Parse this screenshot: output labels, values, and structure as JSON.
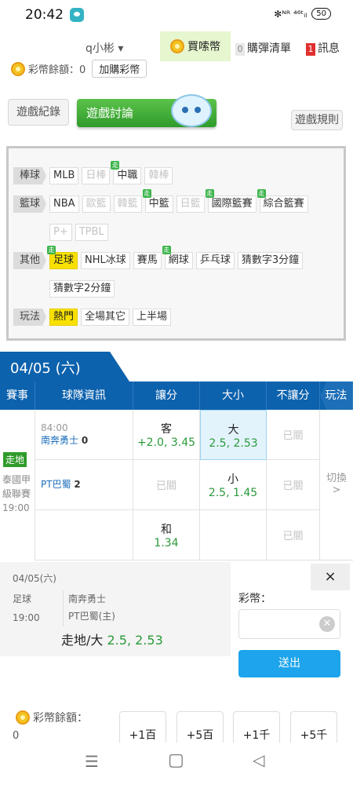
{
  "status": {
    "time": "20:42",
    "indicators": "✻ᴺᴿ ⁴⁶ᵗᵢₗ",
    "battery": "50"
  },
  "topnav": {
    "user": "q小彬 ▾",
    "buy": "買嗦幣",
    "cart_count": "0",
    "cart": "購彈清單",
    "msg_count": "1",
    "msg": "訊息"
  },
  "balance": {
    "label": "彩幣餘額：0",
    "button": "加購彩幣"
  },
  "tabs": {
    "history": "遊戲紀錄",
    "discuss": "遊戲討論",
    "rules": "遊戲規則"
  },
  "categories": {
    "baseball": {
      "head": "棒球",
      "items": [
        "MLB",
        "日棒",
        "中職",
        "韓棒"
      ]
    },
    "basketball": {
      "head": "籃球",
      "items": [
        "NBA",
        "歐籃",
        "韓籃",
        "中籃",
        "日籃",
        "國際籃賽",
        "綜合籃賽",
        "P+",
        "TPBL"
      ]
    },
    "other": {
      "head": "其他",
      "items": [
        "足球",
        "NHL冰球",
        "賽馬",
        "網球",
        "乒乓球",
        "猜數字3分鐘",
        "猜數字2分鐘"
      ]
    },
    "play": {
      "head": "玩法",
      "items": [
        "熱門",
        "全場其它",
        "上半場"
      ]
    },
    "zou_label": "走"
  },
  "date": "04/05 (六)",
  "table": {
    "headers": [
      "賽事",
      "球隊資訊",
      "讓分",
      "大小",
      "不讓分",
      "玩法"
    ],
    "zoudi": "走地",
    "league": "泰國甲級聯賽",
    "time": "19:00",
    "switch": "切換",
    "switch_arrow": ">",
    "team1": {
      "clock": "84:00",
      "name": "南奔勇士",
      "score": "0"
    },
    "team2": {
      "name": "PT巴蜀",
      "score": "2"
    },
    "row1": {
      "handicap_k": "客",
      "handicap_v": "+2.0, 3.45",
      "ou_k": "大",
      "ou_v": "2.5, 2.53",
      "nohandi": "已關"
    },
    "row2": {
      "handicap": "已關",
      "ou_k": "小",
      "ou_v": "2.5, 1.45",
      "nohandi": "已關"
    },
    "row3": {
      "draw_k": "和",
      "draw_v": "1.34",
      "nohandi": "已關"
    }
  },
  "bet": {
    "date": "04/05(六)",
    "sport": "足球",
    "time": "19:00",
    "home": "南奔勇士",
    "away": "PT巴蜀(主)",
    "pick_label": "走地/大",
    "pick_value": "2.5, 2.53",
    "coin_label": "彩幣：",
    "submit": "送出",
    "balance_label": "彩幣餘額：",
    "balance_value": "0",
    "close": "×",
    "amounts": [
      "+1百",
      "+5百",
      "+1千",
      "+5千"
    ]
  },
  "navbar": {
    "menu": "☰",
    "home": "▢",
    "back": "◁"
  }
}
